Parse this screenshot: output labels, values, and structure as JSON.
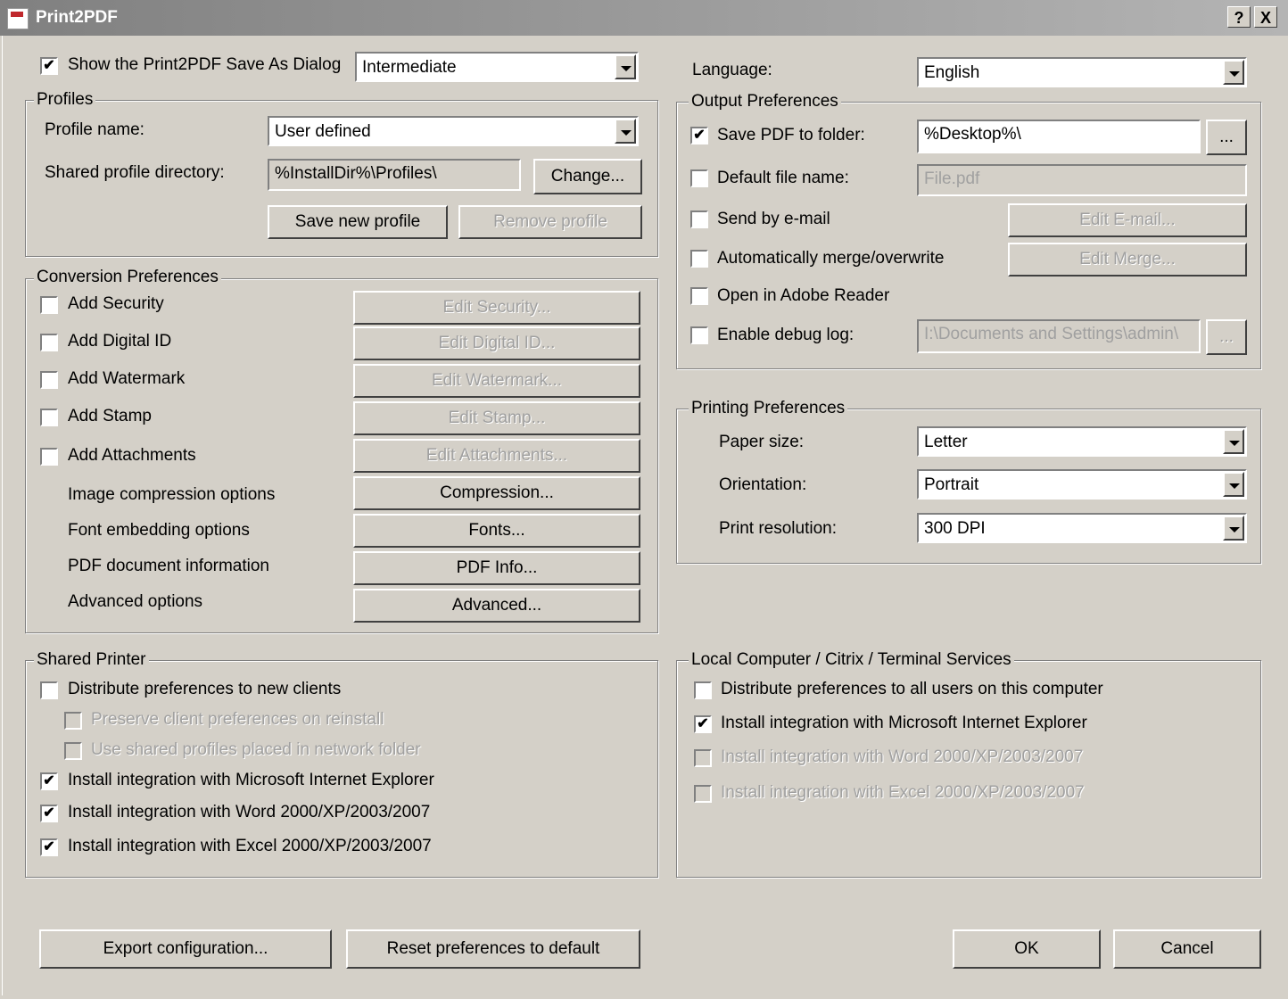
{
  "window": {
    "title": "Print2PDF",
    "help_btn": "?",
    "close_btn": "X"
  },
  "top": {
    "show_dialog_label": "Show the Print2PDF Save As Dialog",
    "show_dialog_checked": "✔",
    "dialog_mode": "Intermediate",
    "language_label": "Language:",
    "language_value": "English"
  },
  "profiles": {
    "title": "Profiles",
    "profile_name_label": "Profile name:",
    "profile_name_value": "User defined",
    "shared_dir_label": "Shared profile directory:",
    "shared_dir_value": "%InstallDir%\\Profiles\\",
    "change_button": "Change...",
    "save_button": "Save new profile",
    "remove_button": "Remove profile"
  },
  "conversion": {
    "title": "Conversion Preferences",
    "security_label": "Add Security",
    "security_button": "Edit Security...",
    "digital_id_label": "Add Digital ID",
    "digital_id_button": "Edit Digital ID...",
    "watermark_label": "Add Watermark",
    "watermark_button": "Edit Watermark...",
    "stamp_label": "Add Stamp",
    "stamp_button": "Edit Stamp...",
    "attachments_label": "Add Attachments",
    "attachments_button": "Edit Attachments...",
    "compression_label": "Image compression options",
    "compression_button": "Compression...",
    "fonts_label": "Font embedding options",
    "fonts_button": "Fonts...",
    "pdfinfo_label": "PDF document information",
    "pdfinfo_button": "PDF Info...",
    "advanced_label": "Advanced options",
    "advanced_button": "Advanced..."
  },
  "output": {
    "title": "Output Preferences",
    "save_folder_label": "Save PDF to folder:",
    "save_folder_checked": "✔",
    "save_folder_value": "%Desktop%\\",
    "browse_button": "...",
    "default_name_label": "Default file name:",
    "default_name_value": "File.pdf",
    "email_label": "Send by e-mail",
    "email_button": "Edit E-mail...",
    "merge_label": "Automatically merge/overwrite",
    "merge_button": "Edit Merge...",
    "adobe_label": "Open in Adobe Reader",
    "debug_label": "Enable debug log:",
    "debug_value": "I:\\Documents and Settings\\admin\\",
    "debug_browse": "..."
  },
  "printing": {
    "title": "Printing Preferences",
    "paper_label": "Paper size:",
    "paper_value": "Letter",
    "orientation_label": "Orientation:",
    "orientation_value": "Portrait",
    "resolution_label": "Print resolution:",
    "resolution_value": "300 DPI"
  },
  "shared_printer": {
    "title": "Shared Printer",
    "distribute_label": "Distribute preferences to new clients",
    "preserve_label": "Preserve client preferences on reinstall",
    "shared_profiles_label": "Use shared profiles placed in network folder",
    "ie_label": "Install integration with Microsoft Internet Explorer",
    "word_label": "Install integration with Word 2000/XP/2003/2007",
    "excel_label": "Install integration with Excel 2000/XP/2003/2007",
    "check_mark": "✔"
  },
  "local": {
    "title": "Local Computer / Citrix / Terminal Services",
    "distribute_label": "Distribute preferences to all users on this computer",
    "ie_label": "Install integration with Microsoft Internet Explorer",
    "word_label": "Install integration with Word 2000/XP/2003/2007",
    "excel_label": "Install integration with Excel 2000/XP/2003/2007",
    "check_mark": "✔"
  },
  "footer": {
    "export_button": "Export configuration...",
    "reset_button": "Reset preferences to default",
    "ok_button": "OK",
    "cancel_button": "Cancel"
  }
}
